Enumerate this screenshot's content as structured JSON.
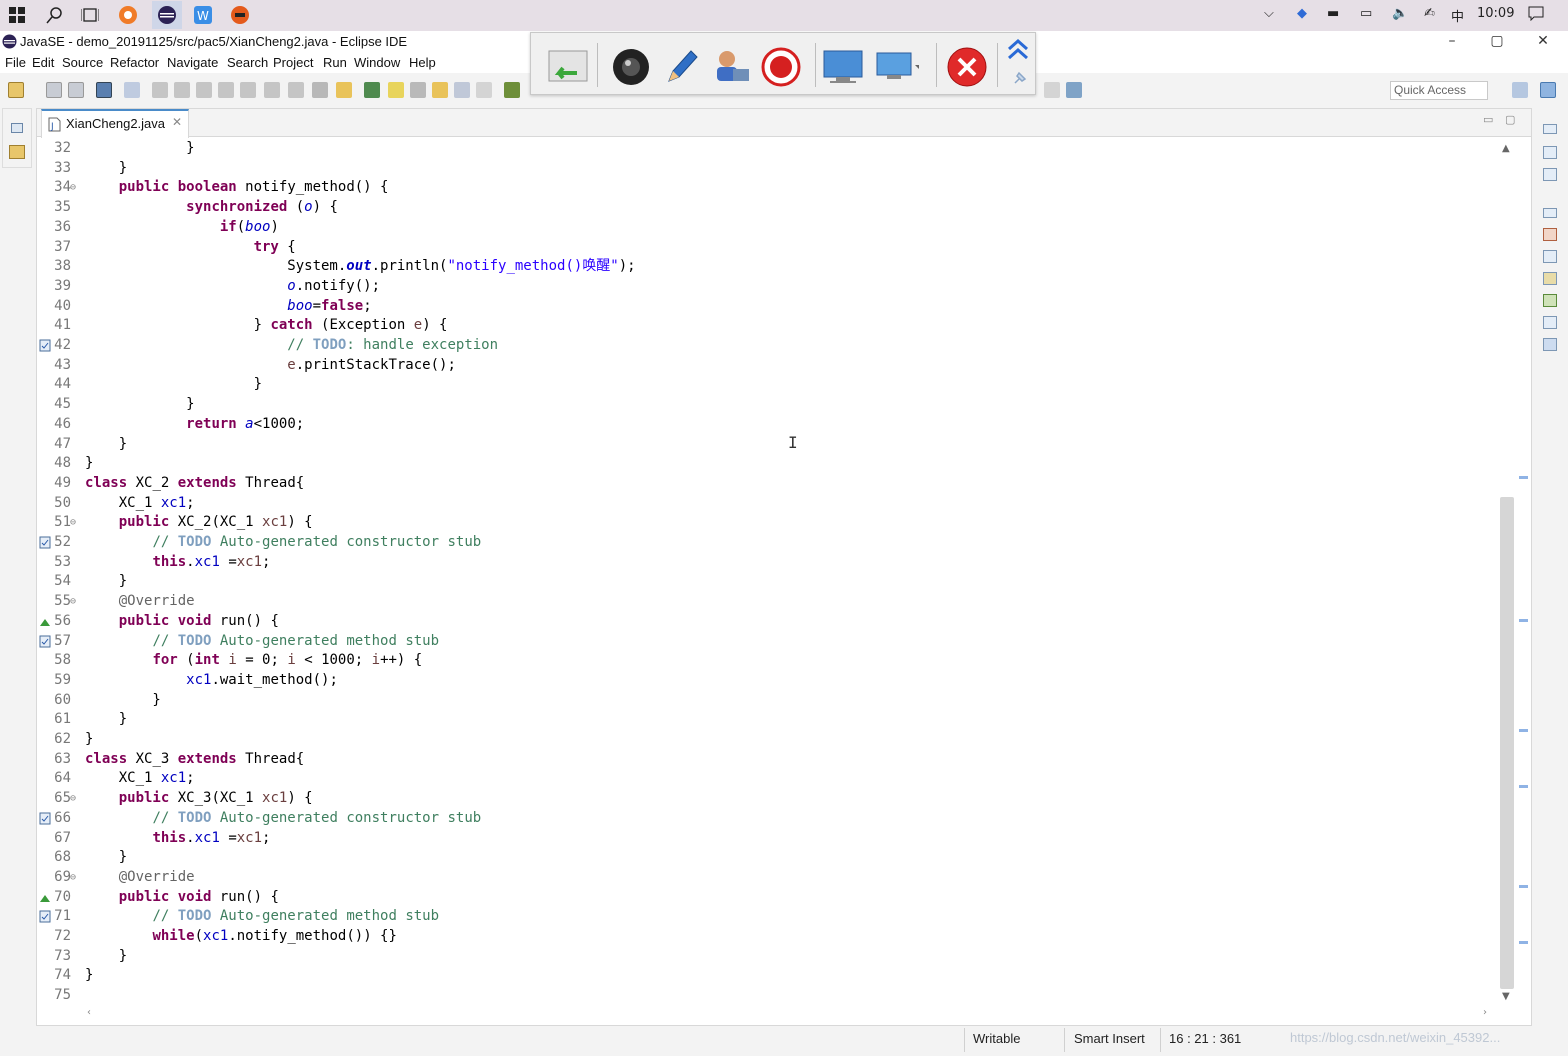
{
  "taskbar": {
    "clock": "10:09",
    "ime": "中"
  },
  "window": {
    "title": "JavaSE - demo_20191125/src/pac5/XianCheng2.java - Eclipse IDE",
    "minimize": "–",
    "maximize": "▢",
    "close": "✕"
  },
  "menu": [
    "File",
    "Edit",
    "Source",
    "Refactor",
    "Navigate",
    "Search",
    "Project",
    "Run",
    "Window",
    "Help"
  ],
  "toolbar": {
    "quick_access_placeholder": "Quick Access"
  },
  "editor": {
    "tab_title": "XianCheng2.java",
    "tab_close": "✕",
    "lines": [
      {
        "n": "32",
        "segs": [
          [
            "",
            "            }"
          ]
        ]
      },
      {
        "n": "33",
        "segs": [
          [
            "",
            "    }"
          ]
        ]
      },
      {
        "n": "34",
        "fold": "⊖",
        "segs": [
          [
            "",
            "    "
          ],
          [
            "kw",
            "public"
          ],
          [
            "",
            " "
          ],
          [
            "kw",
            "boolean"
          ],
          [
            "",
            " notify_method() {"
          ]
        ]
      },
      {
        "n": "35",
        "segs": [
          [
            "",
            "            "
          ],
          [
            "kw",
            "synchronized"
          ],
          [
            "",
            " ("
          ],
          [
            "fld ital",
            "o"
          ],
          [
            "",
            ") {"
          ]
        ]
      },
      {
        "n": "36",
        "segs": [
          [
            "",
            "                "
          ],
          [
            "kw",
            "if"
          ],
          [
            "",
            "("
          ],
          [
            "fld ital",
            "boo"
          ],
          [
            "",
            ")"
          ]
        ]
      },
      {
        "n": "37",
        "segs": [
          [
            "",
            "                    "
          ],
          [
            "kw",
            "try"
          ],
          [
            "",
            " {"
          ]
        ]
      },
      {
        "n": "38",
        "segs": [
          [
            "",
            "                        System."
          ],
          [
            "fld ital kw",
            "out"
          ],
          [
            "",
            ".println("
          ],
          [
            "str",
            "\"notify_method()唤醒\""
          ],
          [
            "",
            ");"
          ]
        ]
      },
      {
        "n": "39",
        "segs": [
          [
            "",
            "                        "
          ],
          [
            "fld ital",
            "o"
          ],
          [
            "",
            ".notify();"
          ]
        ]
      },
      {
        "n": "40",
        "segs": [
          [
            "",
            "                        "
          ],
          [
            "fld ital",
            "boo"
          ],
          [
            "",
            "="
          ],
          [
            "kw",
            "false"
          ],
          [
            "",
            ";"
          ]
        ]
      },
      {
        "n": "41",
        "segs": [
          [
            "",
            "                    } "
          ],
          [
            "kw",
            "catch"
          ],
          [
            "",
            " (Exception "
          ],
          [
            "ph",
            "e"
          ],
          [
            "",
            ") {"
          ]
        ]
      },
      {
        "n": "42",
        "mark": "task",
        "segs": [
          [
            "",
            "                        "
          ],
          [
            "cm",
            "// "
          ],
          [
            "todo",
            "TODO"
          ],
          [
            "cm",
            ": handle exception"
          ]
        ]
      },
      {
        "n": "43",
        "segs": [
          [
            "",
            "                        "
          ],
          [
            "ph",
            "e"
          ],
          [
            "",
            ".printStackTrace();"
          ]
        ]
      },
      {
        "n": "44",
        "segs": [
          [
            "",
            "                    }"
          ]
        ]
      },
      {
        "n": "45",
        "segs": [
          [
            "",
            "            }"
          ]
        ]
      },
      {
        "n": "46",
        "segs": [
          [
            "",
            "            "
          ],
          [
            "kw",
            "return"
          ],
          [
            "",
            " "
          ],
          [
            "fld ital",
            "a"
          ],
          [
            "",
            "<1000;"
          ]
        ]
      },
      {
        "n": "47",
        "segs": [
          [
            "",
            "    }"
          ]
        ]
      },
      {
        "n": "48",
        "segs": [
          [
            "",
            "}"
          ]
        ]
      },
      {
        "n": "49",
        "segs": [
          [
            "kw",
            "class"
          ],
          [
            "",
            " XC_2 "
          ],
          [
            "kw",
            "extends"
          ],
          [
            "",
            " Thread{"
          ]
        ]
      },
      {
        "n": "50",
        "segs": [
          [
            "",
            "    XC_1 "
          ],
          [
            "fld",
            "xc1"
          ],
          [
            "",
            ";"
          ]
        ]
      },
      {
        "n": "51",
        "fold": "⊖",
        "segs": [
          [
            "",
            "    "
          ],
          [
            "kw",
            "public"
          ],
          [
            "",
            " XC_2(XC_1 "
          ],
          [
            "ph",
            "xc1"
          ],
          [
            "",
            ") {"
          ]
        ]
      },
      {
        "n": "52",
        "mark": "task",
        "segs": [
          [
            "",
            "        "
          ],
          [
            "cm",
            "// "
          ],
          [
            "todo",
            "TODO"
          ],
          [
            "cm",
            " Auto-generated constructor stub"
          ]
        ]
      },
      {
        "n": "53",
        "segs": [
          [
            "",
            "        "
          ],
          [
            "kw",
            "this"
          ],
          [
            "",
            "."
          ],
          [
            "fld",
            "xc1"
          ],
          [
            "",
            " ="
          ],
          [
            "ph",
            "xc1"
          ],
          [
            "",
            ";"
          ]
        ]
      },
      {
        "n": "54",
        "segs": [
          [
            "",
            "    }"
          ]
        ]
      },
      {
        "n": "55",
        "fold": "⊖",
        "segs": [
          [
            "",
            "    "
          ],
          [
            "ann",
            "@Override"
          ]
        ]
      },
      {
        "n": "56",
        "mark": "override",
        "segs": [
          [
            "",
            "    "
          ],
          [
            "kw",
            "public"
          ],
          [
            "",
            " "
          ],
          [
            "kw",
            "void"
          ],
          [
            "",
            " run() {"
          ]
        ]
      },
      {
        "n": "57",
        "mark": "task",
        "segs": [
          [
            "",
            "        "
          ],
          [
            "cm",
            "// "
          ],
          [
            "todo",
            "TODO"
          ],
          [
            "cm",
            " Auto-generated method stub"
          ]
        ]
      },
      {
        "n": "58",
        "segs": [
          [
            "",
            "        "
          ],
          [
            "kw",
            "for"
          ],
          [
            "",
            " ("
          ],
          [
            "kw",
            "int"
          ],
          [
            "",
            " "
          ],
          [
            "ph",
            "i"
          ],
          [
            "",
            " = 0; "
          ],
          [
            "ph",
            "i"
          ],
          [
            "",
            " < 1000; "
          ],
          [
            "ph",
            "i"
          ],
          [
            "",
            "++) {"
          ]
        ]
      },
      {
        "n": "59",
        "segs": [
          [
            "",
            "            "
          ],
          [
            "fld",
            "xc1"
          ],
          [
            "",
            ".wait_method();"
          ]
        ]
      },
      {
        "n": "60",
        "segs": [
          [
            "",
            "        }"
          ]
        ]
      },
      {
        "n": "61",
        "segs": [
          [
            "",
            "    }"
          ]
        ]
      },
      {
        "n": "62",
        "segs": [
          [
            "",
            "}"
          ]
        ]
      },
      {
        "n": "63",
        "segs": [
          [
            "kw",
            "class"
          ],
          [
            "",
            " XC_3 "
          ],
          [
            "kw",
            "extends"
          ],
          [
            "",
            " Thread{"
          ]
        ]
      },
      {
        "n": "64",
        "segs": [
          [
            "",
            "    XC_1 "
          ],
          [
            "fld",
            "xc1"
          ],
          [
            "",
            ";"
          ]
        ]
      },
      {
        "n": "65",
        "fold": "⊖",
        "segs": [
          [
            "",
            "    "
          ],
          [
            "kw",
            "public"
          ],
          [
            "",
            " XC_3(XC_1 "
          ],
          [
            "ph",
            "xc1"
          ],
          [
            "",
            ") {"
          ]
        ]
      },
      {
        "n": "66",
        "mark": "task",
        "segs": [
          [
            "",
            "        "
          ],
          [
            "cm",
            "// "
          ],
          [
            "todo",
            "TODO"
          ],
          [
            "cm",
            " Auto-generated constructor stub"
          ]
        ]
      },
      {
        "n": "67",
        "segs": [
          [
            "",
            "        "
          ],
          [
            "kw",
            "this"
          ],
          [
            "",
            "."
          ],
          [
            "fld",
            "xc1"
          ],
          [
            "",
            " ="
          ],
          [
            "ph",
            "xc1"
          ],
          [
            "",
            ";"
          ]
        ]
      },
      {
        "n": "68",
        "segs": [
          [
            "",
            "    }"
          ]
        ]
      },
      {
        "n": "69",
        "fold": "⊖",
        "segs": [
          [
            "",
            "    "
          ],
          [
            "ann",
            "@Override"
          ]
        ]
      },
      {
        "n": "70",
        "mark": "override",
        "segs": [
          [
            "",
            "    "
          ],
          [
            "kw",
            "public"
          ],
          [
            "",
            " "
          ],
          [
            "kw",
            "void"
          ],
          [
            "",
            " run() {"
          ]
        ]
      },
      {
        "n": "71",
        "mark": "task",
        "segs": [
          [
            "",
            "        "
          ],
          [
            "cm",
            "// "
          ],
          [
            "todo",
            "TODO"
          ],
          [
            "cm",
            " Auto-generated method stub"
          ]
        ]
      },
      {
        "n": "72",
        "segs": [
          [
            "",
            "        "
          ],
          [
            "kw",
            "while"
          ],
          [
            "",
            "("
          ],
          [
            "fld",
            "xc1"
          ],
          [
            "",
            ".notify_method()) {}"
          ]
        ]
      },
      {
        "n": "73",
        "segs": [
          [
            "",
            "    }"
          ]
        ]
      },
      {
        "n": "74",
        "segs": [
          [
            "",
            "}"
          ]
        ]
      },
      {
        "n": "75",
        "segs": [
          [
            "",
            ""
          ]
        ]
      }
    ]
  },
  "status": {
    "writable": "Writable",
    "insert_mode": "Smart Insert",
    "position": "16 : 21 : 361",
    "watermark": "https://blog.csdn.net/weixin_45392..."
  },
  "colors": {
    "keyword": "#7f0055",
    "comment": "#3f7f5f",
    "string": "#2a00ff",
    "field": "#0000c0",
    "tab_accent": "#4a8bc9"
  }
}
